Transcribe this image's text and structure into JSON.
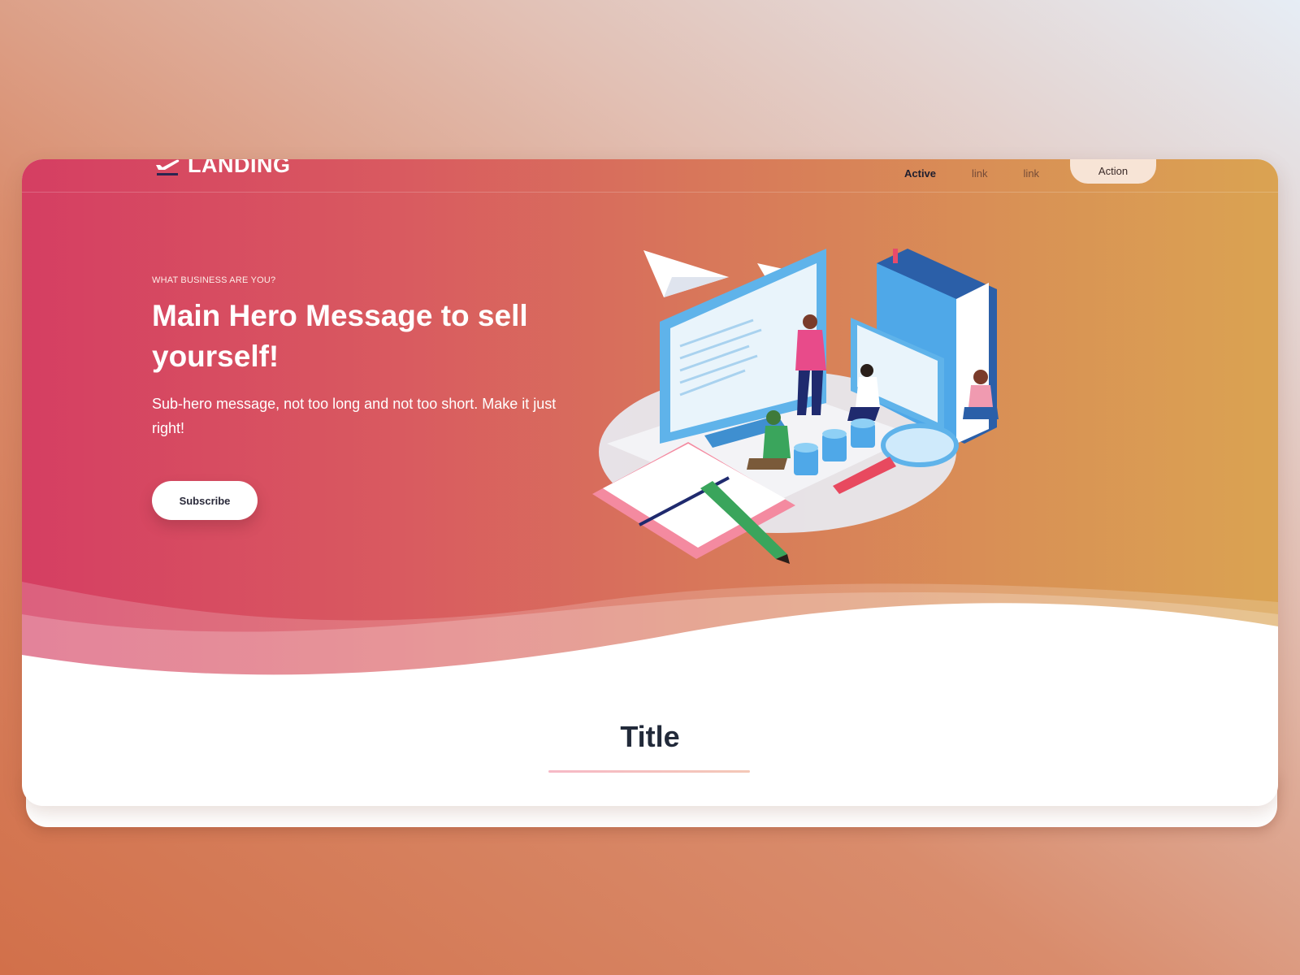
{
  "brand": {
    "name": "LANDING",
    "logo_icon": "plane-departure-icon"
  },
  "nav": {
    "links": [
      {
        "label": "Active",
        "active": true
      },
      {
        "label": "link",
        "active": false
      },
      {
        "label": "link",
        "active": false
      }
    ],
    "action_label": "Action"
  },
  "hero": {
    "kicker": "WHAT BUSINESS ARE YOU?",
    "title": "Main Hero Message to sell yourself!",
    "subtitle": "Sub-hero message, not too long and not too short. Make it just right!",
    "button_label": "Subscribe",
    "illustration": "isometric-team-working-illustration"
  },
  "section": {
    "title": "Title"
  },
  "colors": {
    "gradient_start": "#d53e62",
    "gradient_end": "#daa352",
    "title_text": "#222a3a",
    "action_bg": "#f7e4d6"
  }
}
